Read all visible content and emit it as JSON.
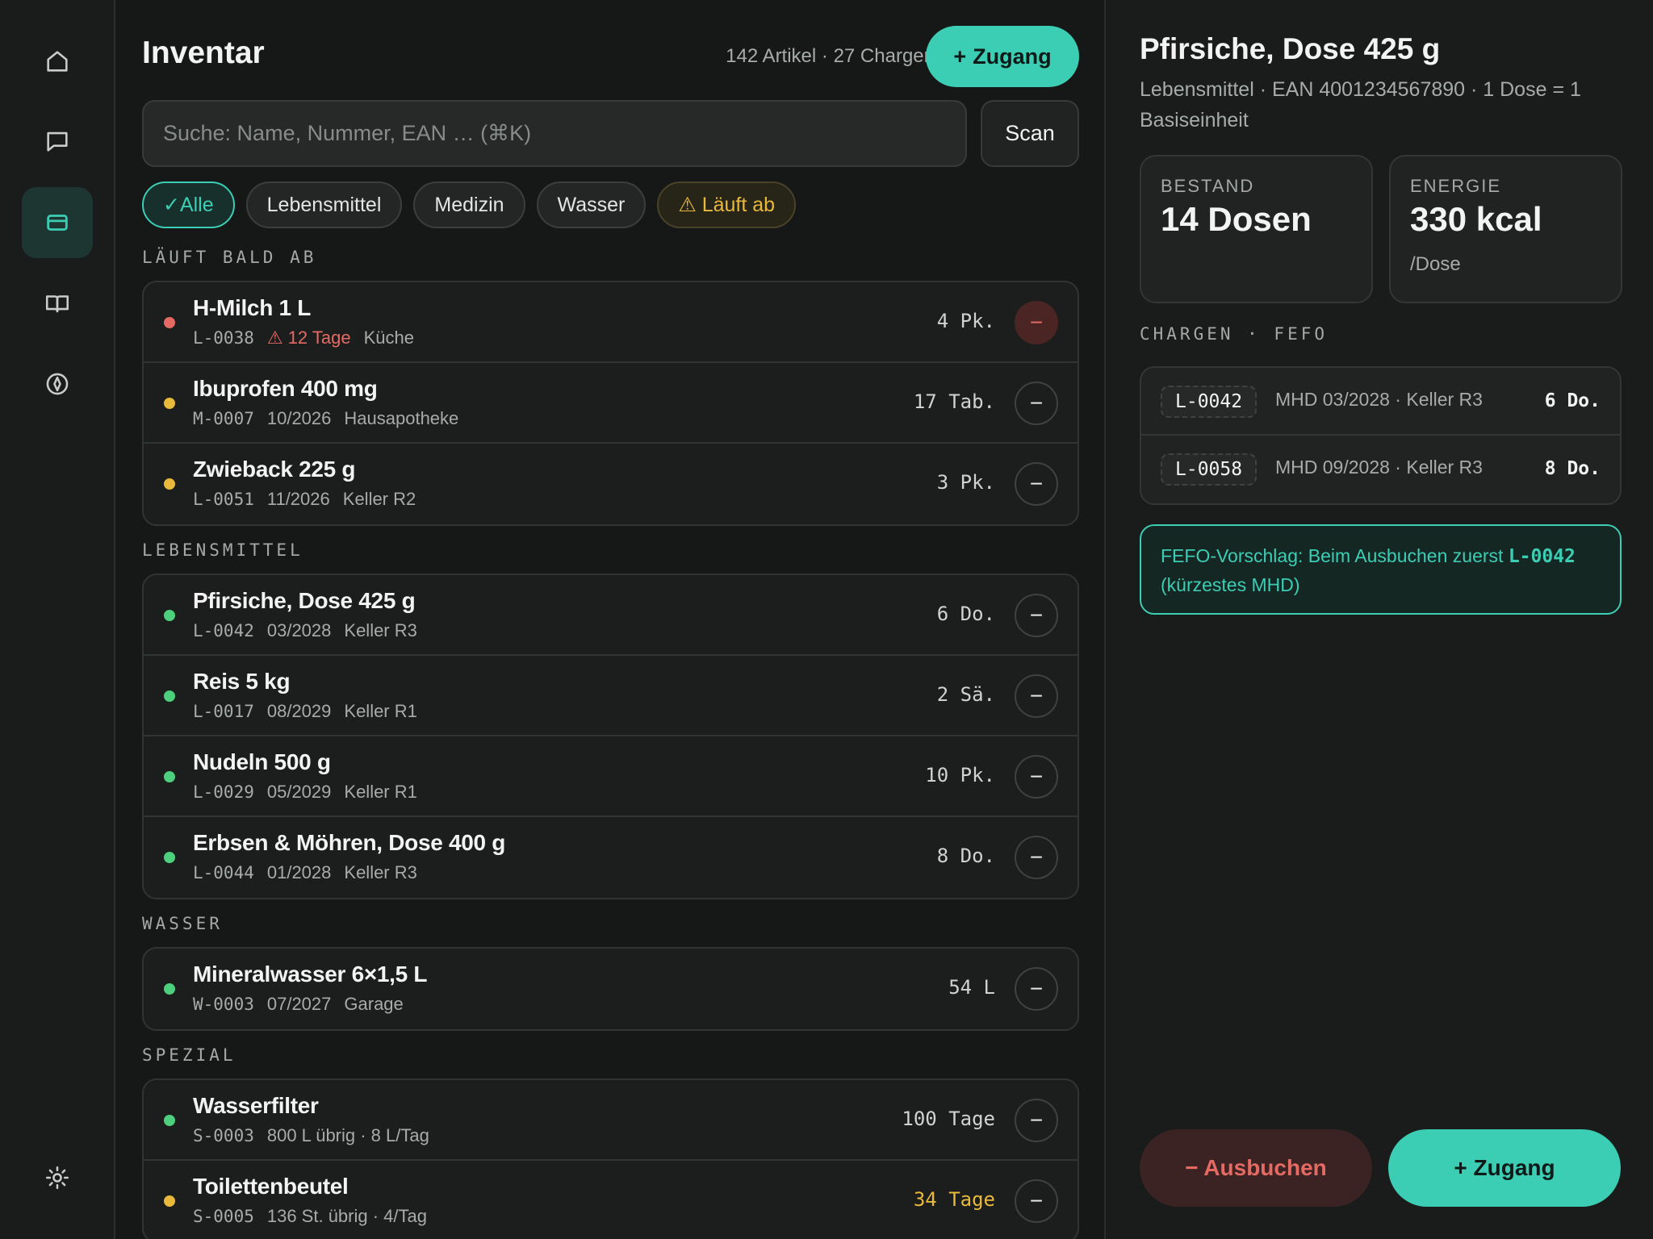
{
  "sidebar": {
    "icons": [
      "home-icon",
      "chat-icon",
      "card-icon",
      "book-icon",
      "compass-icon",
      "settings-icon"
    ]
  },
  "header": {
    "title": "Inventar",
    "summary": "142 Artikel · 27 Chargen",
    "add_label": "Zugang"
  },
  "search": {
    "placeholder": "Suche: Name, Nummer, EAN … (⌘K)"
  },
  "scan_label": "Scan",
  "filters": [
    {
      "label": "✓Alle",
      "state": "active"
    },
    {
      "label": "Lebensmittel",
      "state": "normal"
    },
    {
      "label": "Medizin",
      "state": "normal"
    },
    {
      "label": "Wasser",
      "state": "normal"
    },
    {
      "label": "⚠ Läuft ab",
      "state": "warn"
    }
  ],
  "sections": [
    {
      "title": "LÄUFT BALD AB",
      "items": [
        {
          "name": "H-Milch 1 L",
          "code": "L-0038",
          "expiry": "⚠ 12 Tage",
          "expiry_warn": true,
          "location": "Küche",
          "qty": "4 Pk.",
          "status": "red"
        },
        {
          "name": "Ibuprofen 400 mg",
          "code": "M-0007",
          "expiry": "10/2026",
          "location": "Hausapotheke",
          "qty": "17 Tab.",
          "status": "amber"
        },
        {
          "name": "Zwieback 225 g",
          "code": "L-0051",
          "expiry": "11/2026",
          "location": "Keller R2",
          "qty": "3 Pk.",
          "status": "amber"
        }
      ]
    },
    {
      "title": "LEBENSMITTEL",
      "items": [
        {
          "name": "Pfirsiche, Dose 425 g",
          "code": "L-0042",
          "expiry": "03/2028",
          "location": "Keller R3",
          "qty": "6 Do.",
          "status": "green"
        },
        {
          "name": "Reis 5 kg",
          "code": "L-0017",
          "expiry": "08/2029",
          "location": "Keller R1",
          "qty": "2 Sä.",
          "status": "green"
        },
        {
          "name": "Nudeln 500 g",
          "code": "L-0029",
          "expiry": "05/2029",
          "location": "Keller R1",
          "qty": "10 Pk.",
          "status": "green"
        },
        {
          "name": "Erbsen & Möhren, Dose 400 g",
          "code": "L-0044",
          "expiry": "01/2028",
          "location": "Keller R3",
          "qty": "8 Do.",
          "status": "green"
        }
      ]
    },
    {
      "title": "WASSER",
      "items": [
        {
          "name": "Mineralwasser 6×1,5 L",
          "code": "W-0003",
          "expiry": "07/2027",
          "location": "Garage",
          "qty": "54 L",
          "status": "green"
        }
      ]
    },
    {
      "title": "SPEZIAL",
      "items": [
        {
          "name": "Wasserfilter",
          "code": "S-0003",
          "expiry": "800 L übrig · 8 L/Tag",
          "location": "",
          "qty": "100 Tage",
          "status": "green"
        },
        {
          "name": "Toilettenbeutel",
          "code": "S-0005",
          "expiry": "136 St. übrig · 4/Tag",
          "location": "",
          "qty": "34 Tage",
          "qty_amber": true,
          "status": "amber"
        }
      ]
    }
  ],
  "detail": {
    "title": "Pfirsiche, Dose 425 g",
    "subtitle": "Lebensmittel · EAN 4001234567890 · 1 Dose = 1 Basiseinheit",
    "stock_label": "BESTAND",
    "stock_value": "14 Dosen",
    "energy_label": "ENERGIE",
    "energy_value": "330 kcal",
    "energy_unit": "/Dose",
    "batches_title": "CHARGEN · FEFO",
    "batches": [
      {
        "code": "L-0042",
        "info": "MHD 03/2028 · Keller R3",
        "qty": "6 Do."
      },
      {
        "code": "L-0058",
        "info": "MHD 09/2028 · Keller R3",
        "qty": "8 Do."
      }
    ],
    "fefo_prefix": "FEFO-Vorschlag: Beim Ausbuchen zuerst ",
    "fefo_code": "L-0042",
    "fefo_suffix": "(kürzestes MHD)",
    "out_label": "− Ausbuchen",
    "in_label": "+ Zugang"
  },
  "colors": {
    "accent": "#3CCDB5",
    "red": "#E56A63",
    "amber": "#E9B93C",
    "green": "#4CD07D"
  }
}
